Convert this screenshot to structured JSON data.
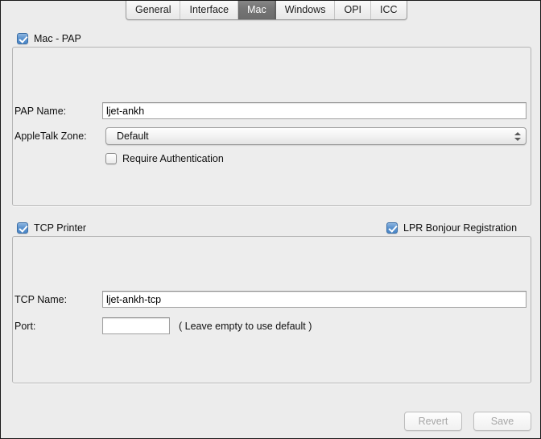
{
  "tabs": [
    {
      "label": "General",
      "selected": false
    },
    {
      "label": "Interface",
      "selected": false
    },
    {
      "label": "Mac",
      "selected": true
    },
    {
      "label": "Windows",
      "selected": false
    },
    {
      "label": "OPI",
      "selected": false
    },
    {
      "label": "ICC",
      "selected": false
    }
  ],
  "pap_section": {
    "enable_label": "Mac - PAP",
    "enable_checked": true,
    "pap_name_label": "PAP Name:",
    "pap_name_value": "ljet-ankh",
    "pap_name_placeholder": "",
    "zone_label": "AppleTalk Zone:",
    "zone_value": "Default",
    "require_auth_label": "Require Authentication",
    "require_auth_checked": false
  },
  "tcp_section": {
    "enable_label": "TCP Printer",
    "enable_checked": true,
    "bonjour_label": "LPR Bonjour Registration",
    "bonjour_checked": true,
    "tcp_name_label": "TCP Name:",
    "tcp_name_value": "ljet-ankh-tcp",
    "tcp_name_placeholder": "",
    "port_label": "Port:",
    "port_value": "",
    "port_placeholder": "",
    "port_hint": "( Leave empty to use default )"
  },
  "footer": {
    "revert_label": "Revert",
    "save_label": "Save"
  },
  "colors": {
    "window_background": "#ececec",
    "group_background": "#ededed",
    "accent_checkbox": "#5d94cf",
    "selected_tab": "#757575",
    "disabled_text": "#a6a6a6"
  }
}
